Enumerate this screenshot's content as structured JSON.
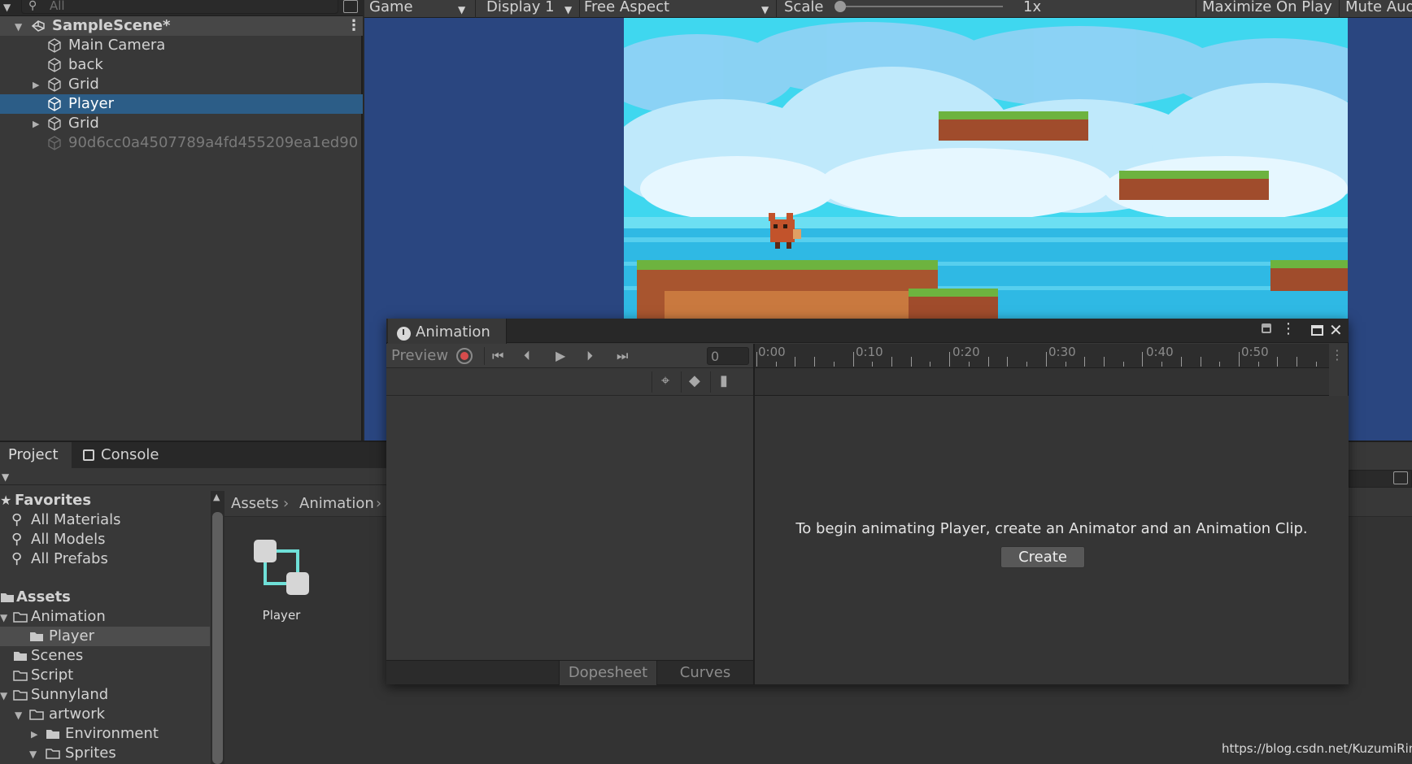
{
  "hierarchy": {
    "search_placeholder": "All",
    "scene_name": "SampleScene*",
    "items": [
      {
        "label": "Main Camera"
      },
      {
        "label": "back"
      },
      {
        "label": "Grid"
      },
      {
        "label": "Player"
      },
      {
        "label": "Grid"
      },
      {
        "label": "90d6cc0a4507789a4fd455209ea1ed90"
      }
    ]
  },
  "game_toolbar": {
    "view": "Game",
    "display": "Display 1",
    "aspect": "Free Aspect",
    "scale_label": "Scale",
    "scale_value": "1x",
    "maximize": "Maximize On Play",
    "mute": "Mute Audi"
  },
  "project_panel": {
    "tabs": [
      "Project",
      "Console"
    ],
    "favorites": {
      "label": "Favorites",
      "items": [
        "All Materials",
        "All Models",
        "All Prefabs"
      ]
    },
    "assets_label": "Assets",
    "tree": [
      "Animation",
      "Player",
      "Scenes",
      "Script",
      "Sunnyland",
      "artwork",
      "Environment",
      "Sprites"
    ],
    "breadcrumb": [
      "Assets",
      "Animation"
    ],
    "asset_items": [
      {
        "label": "Player",
        "icon": "animator-controller-icon"
      }
    ]
  },
  "animation_window": {
    "title": "Animation",
    "preview_label": "Preview",
    "frame_value": "0",
    "timeline_labels": [
      "0:00",
      "0:10",
      "0:20",
      "0:30",
      "0:40",
      "0:50"
    ],
    "message": "To begin animating Player, create an Animator and an Animation Clip.",
    "create_label": "Create",
    "bottom_tabs": [
      "Dopesheet",
      "Curves"
    ]
  },
  "watermark": "https://blog.csdn.net/KuzumiRin",
  "colors": {
    "selection": "#2c5d87",
    "sky": "#3fd7ef",
    "game_bg": "#2a4680",
    "record": "#d84c4c",
    "controller_icon": "#6fe0d8"
  }
}
